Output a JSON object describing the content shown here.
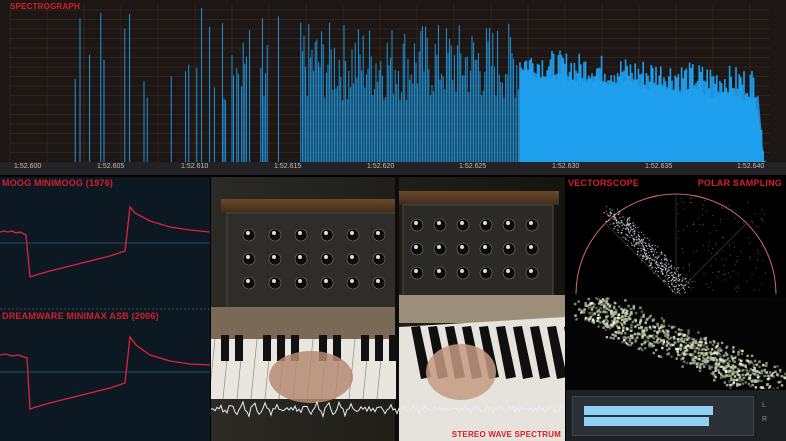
{
  "spectrograph": {
    "title": "SPECTROGRAPH",
    "time_ticks": [
      "1:52.600",
      "1:52.605",
      "1:52.610",
      "1:52.615",
      "1:52.620",
      "1:52.625",
      "1:52.630",
      "1:52.635",
      "1:52.640"
    ],
    "bar_color": "#1fa0ee",
    "grid_color": "#4a2e25"
  },
  "moog": {
    "title": "MOOG MINIMOOG (1976)",
    "trace_color": "#e0233a"
  },
  "dreamware": {
    "title": "DREAMWARE MINIMAX ASB (2006)",
    "trace_color": "#e0233a"
  },
  "video": {
    "caption": "STEREO WAVE SPECTRUM"
  },
  "vectorscope": {
    "title": "VECTORSCOPE",
    "subtitle": "POLAR SAMPLING"
  },
  "meter": {
    "levels": [
      0.83,
      0.8
    ],
    "channel_labels": [
      "L",
      "R"
    ],
    "bar_color": "#8fd1f3"
  }
}
